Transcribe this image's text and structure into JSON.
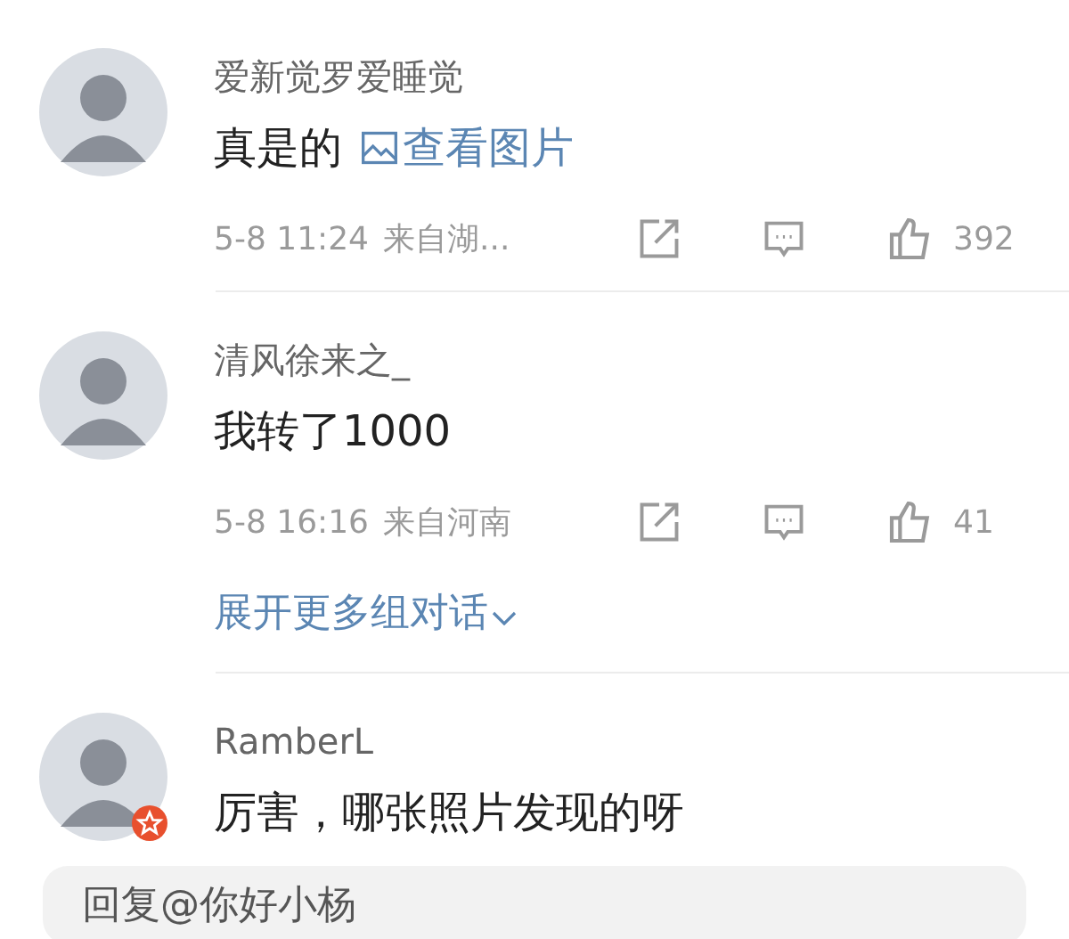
{
  "comments": [
    {
      "name": "爱新觉罗爱睡觉",
      "avatar_badge": false,
      "body": [
        {
          "kind": "text",
          "text": "真是的"
        },
        {
          "kind": "image_link",
          "text": "查看图片"
        }
      ],
      "meta": {
        "time": "5-8 11:24",
        "source": "来自湖...",
        "likes": "392"
      }
    },
    {
      "name": "清风徐来之_",
      "avatar_badge": false,
      "body": [
        {
          "kind": "text",
          "text": "我转了1000"
        }
      ],
      "meta": {
        "time": "5-8 16:16",
        "source": "来自河南",
        "likes": "41"
      },
      "expand_link": "展开更多组对话"
    },
    {
      "name": "RamberL",
      "avatar_badge": true,
      "body": [
        {
          "kind": "text",
          "text": "厉害，哪张照片发现的呀"
        }
      ]
    }
  ],
  "reply_field": {
    "placeholder": "回复@你好小杨"
  }
}
